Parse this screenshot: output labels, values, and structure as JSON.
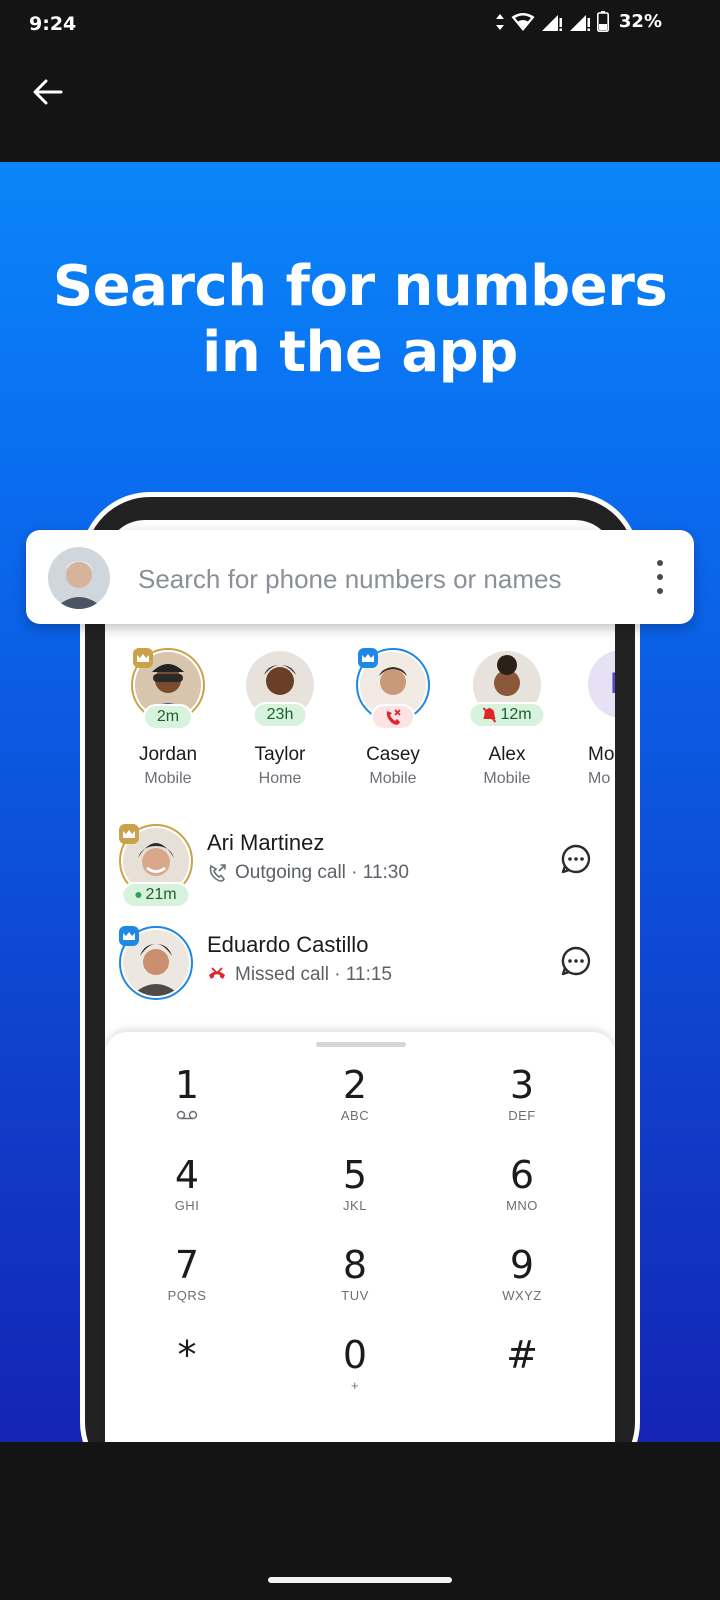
{
  "status_bar": {
    "time": "9:24",
    "battery": "32%"
  },
  "headline": "Search for numbers in the app",
  "search": {
    "placeholder": "Search for phone numbers or names"
  },
  "favorites": [
    {
      "name": "Jordan",
      "type": "Mobile",
      "time": "2m"
    },
    {
      "name": "Taylor",
      "type": "Home",
      "time": "23h"
    },
    {
      "name": "Casey",
      "type": "Mobile",
      "time": ""
    },
    {
      "name": "Alex",
      "type": "Mobile",
      "time": "12m"
    },
    {
      "name": "Mo",
      "type": "Mo",
      "initial": "M"
    }
  ],
  "calls": [
    {
      "name": "Ari Martinez",
      "detail": "Outgoing call · 11:30",
      "time": "21m"
    },
    {
      "name": "Eduardo Castillo",
      "detail": "Missed call · 11:15"
    }
  ],
  "dialpad": [
    {
      "digit": "1",
      "sub": ""
    },
    {
      "digit": "2",
      "sub": "ABC"
    },
    {
      "digit": "3",
      "sub": "DEF"
    },
    {
      "digit": "4",
      "sub": "GHI"
    },
    {
      "digit": "5",
      "sub": "JKL"
    },
    {
      "digit": "6",
      "sub": "MNO"
    },
    {
      "digit": "7",
      "sub": "PQRS"
    },
    {
      "digit": "8",
      "sub": "TUV"
    },
    {
      "digit": "9",
      "sub": "WXYZ"
    },
    {
      "digit": "*",
      "sub": ""
    },
    {
      "digit": "0",
      "sub": "+"
    },
    {
      "digit": "#",
      "sub": ""
    }
  ],
  "colors": {
    "hero_top": "#0a86f8",
    "hero_bottom": "#1424b4",
    "pill_bg": "#d7f2dd",
    "missed_red": "#e0242a",
    "premium_gold": "#c9a24a",
    "verified_blue": "#1e88e5"
  },
  "icons": {
    "back": "arrow-left-icon",
    "more": "more-vertical-icon",
    "chat": "chat-bubble-icon",
    "outgoing": "outgoing-call-icon",
    "missed": "missed-call-icon",
    "voicemail": "voicemail-icon"
  }
}
